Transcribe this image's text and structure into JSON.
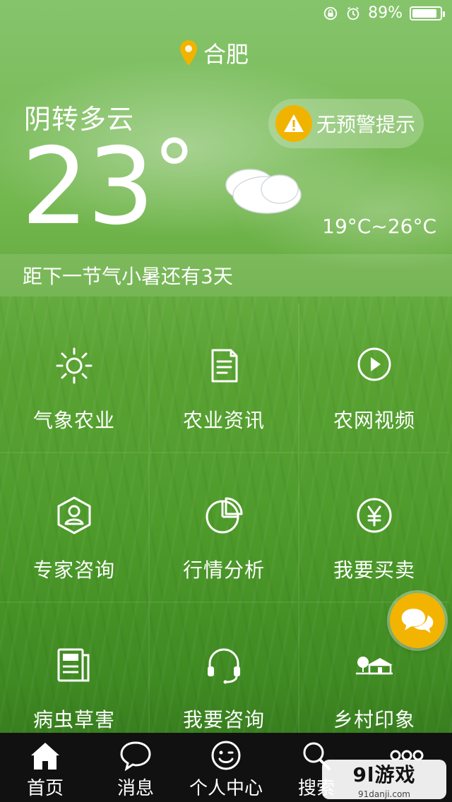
{
  "status_bar": {
    "battery_percent_text": "89%",
    "battery_level": 0.89,
    "icons": [
      "rotation-lock-icon",
      "alarm-icon",
      "battery-icon"
    ]
  },
  "location": {
    "city": "合肥",
    "icon": "location-pin-icon",
    "accent": "#f0b400"
  },
  "weather": {
    "condition": "阴转多云",
    "temperature": "23",
    "degree_symbol": "°",
    "range": "19°C~26°C",
    "icon": "cloudy-icon"
  },
  "warning": {
    "text": "无预警提示",
    "icon": "warning-triangle-icon",
    "color": "#f0b400"
  },
  "solar_term": {
    "text": "距下一节气小暑还有3天"
  },
  "grid": {
    "items": [
      {
        "label": "气象农业",
        "icon": "sun-icon"
      },
      {
        "label": "农业资讯",
        "icon": "document-icon"
      },
      {
        "label": "农网视频",
        "icon": "play-icon"
      },
      {
        "label": "专家咨询",
        "icon": "expert-icon"
      },
      {
        "label": "行情分析",
        "icon": "pie-chart-icon"
      },
      {
        "label": "我要买卖",
        "icon": "yen-icon"
      },
      {
        "label": "病虫草害",
        "icon": "newspaper-icon"
      },
      {
        "label": "我要咨询",
        "icon": "headset-icon"
      },
      {
        "label": "乡村印象",
        "icon": "house-icon"
      }
    ]
  },
  "chat_button": {
    "icon": "chat-bubbles-icon",
    "color": "#f2b400"
  },
  "tab_bar": {
    "tabs": [
      {
        "label": "首页",
        "icon": "home-icon"
      },
      {
        "label": "消息",
        "icon": "message-icon"
      },
      {
        "label": "个人中心",
        "icon": "face-icon"
      },
      {
        "label": "搜索",
        "icon": "search-icon"
      },
      {
        "label": "",
        "icon": "more-icon"
      }
    ]
  },
  "watermark": {
    "main": "9l游戏",
    "sub": "91danji.com"
  }
}
